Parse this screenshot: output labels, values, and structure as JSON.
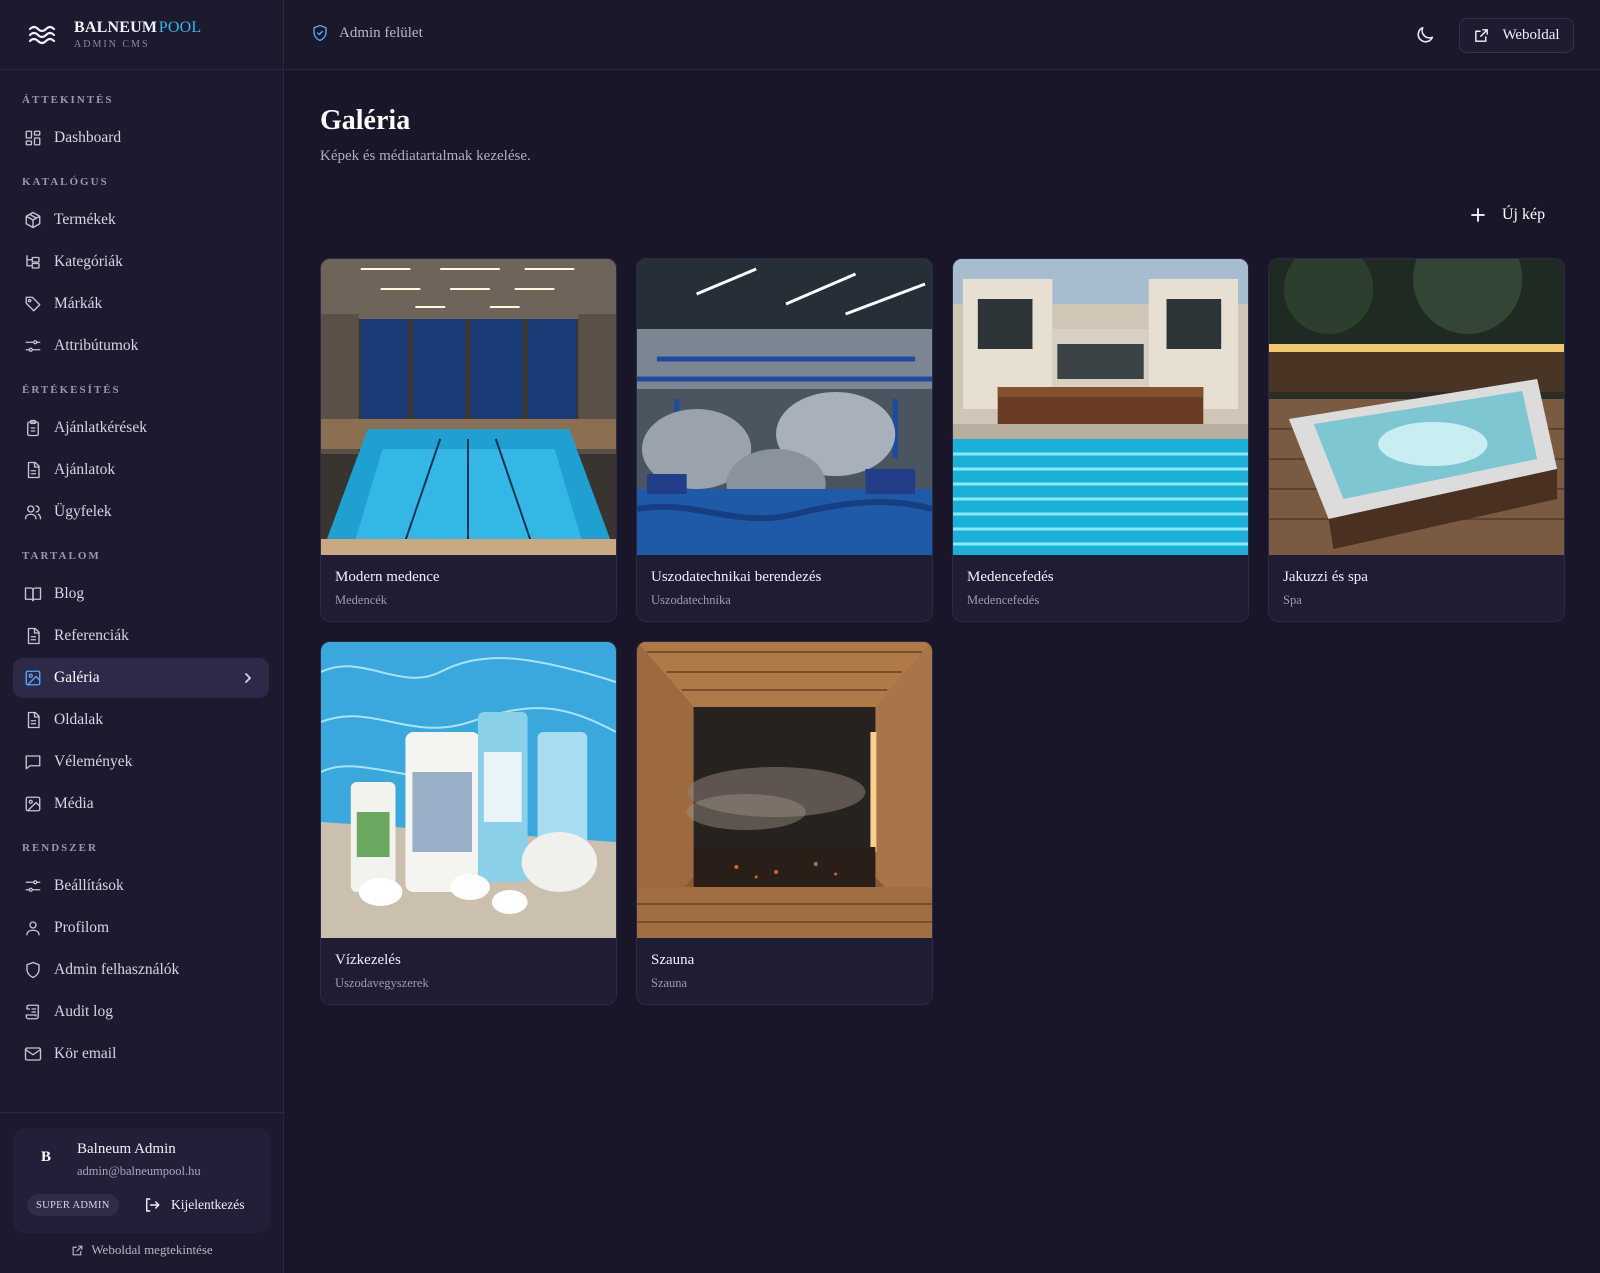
{
  "brand": {
    "name": "BALNEUM",
    "accent": "POOL",
    "subtitle": "ADMIN CMS"
  },
  "topbar": {
    "admin_label": "Admin felület",
    "website_button": "Weboldal"
  },
  "sidebar": {
    "sections": [
      {
        "title": "ÁTTEKINTÉS",
        "items": [
          {
            "label": "Dashboard",
            "icon": "dashboard-icon"
          }
        ]
      },
      {
        "title": "KATALÓGUS",
        "items": [
          {
            "label": "Termékek",
            "icon": "package-icon"
          },
          {
            "label": "Kategóriák",
            "icon": "folder-tree-icon"
          },
          {
            "label": "Márkák",
            "icon": "tag-icon"
          },
          {
            "label": "Attribútumok",
            "icon": "sliders-icon"
          }
        ]
      },
      {
        "title": "ÉRTÉKESÍTÉS",
        "items": [
          {
            "label": "Ajánlatkérések",
            "icon": "clipboard-icon"
          },
          {
            "label": "Ajánlatok",
            "icon": "document-icon"
          },
          {
            "label": "Ügyfelek",
            "icon": "users-icon"
          }
        ]
      },
      {
        "title": "TARTALOM",
        "items": [
          {
            "label": "Blog",
            "icon": "book-icon"
          },
          {
            "label": "Referenciák",
            "icon": "document-icon"
          },
          {
            "label": "Galéria",
            "icon": "image-icon",
            "active": true
          },
          {
            "label": "Oldalak",
            "icon": "document-icon"
          },
          {
            "label": "Vélemények",
            "icon": "message-icon"
          },
          {
            "label": "Média",
            "icon": "image-icon"
          }
        ]
      },
      {
        "title": "RENDSZER",
        "items": [
          {
            "label": "Beállítások",
            "icon": "sliders-icon"
          },
          {
            "label": "Profilom",
            "icon": "user-icon"
          },
          {
            "label": "Admin felhasználók",
            "icon": "shield-icon"
          },
          {
            "label": "Audit log",
            "icon": "scroll-icon"
          },
          {
            "label": "Kör email",
            "icon": "mail-icon"
          }
        ]
      }
    ]
  },
  "user": {
    "initial": "B",
    "name": "Balneum Admin",
    "email": "admin@balneumpool.hu",
    "role": "SUPER ADMIN",
    "logout_label": "Kijelentkezés",
    "view_site_label": "Weboldal megtekintése"
  },
  "page": {
    "title": "Galéria",
    "subtitle": "Képek és médiatartalmak kezelése.",
    "new_button": "Új kép"
  },
  "gallery": [
    {
      "title": "Modern medence",
      "category": "Medencék",
      "image": "indoor-pool"
    },
    {
      "title": "Uszodatechnikai berendezés",
      "category": "Uszodatechnika",
      "image": "pump-room"
    },
    {
      "title": "Medencefedés",
      "category": "Medencefedés",
      "image": "pool-cover"
    },
    {
      "title": "Jakuzzi és spa",
      "category": "Spa",
      "image": "hot-tub"
    },
    {
      "title": "Vízkezelés",
      "category": "Uszodavegyszerek",
      "image": "chemicals"
    },
    {
      "title": "Szauna",
      "category": "Szauna",
      "image": "sauna"
    }
  ],
  "colors": {
    "background": "#181628",
    "sidebar": "#1b1a2e",
    "active": "#2c2a48",
    "accent": "#38b6e8",
    "card": "#1f1d33"
  }
}
